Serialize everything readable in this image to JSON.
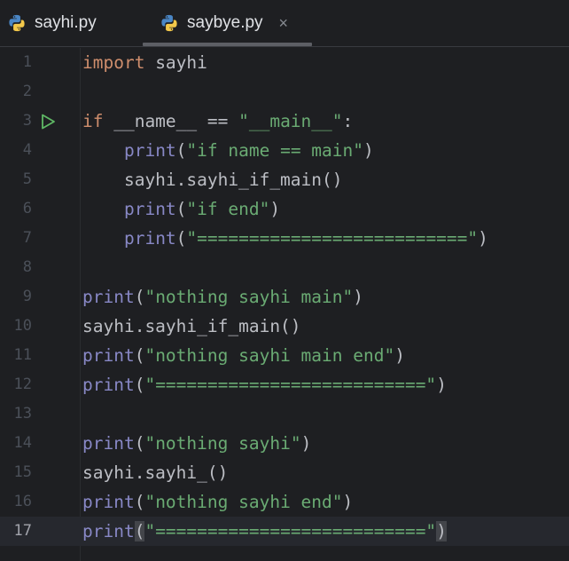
{
  "tabs": [
    {
      "label": "sayhi.py",
      "active": false
    },
    {
      "label": "saybye.py",
      "active": true,
      "close_glyph": "×"
    }
  ],
  "colors": {
    "background": "#1e1f22",
    "keyword": "#cf8e6d",
    "builtin": "#8888c6",
    "string": "#6aab73",
    "identifier": "#bcbec4",
    "run_gutter_icon": "#5fb865"
  },
  "icons": {
    "tab_icon": "python-icon",
    "gutter_icon": "run-icon"
  },
  "editor": {
    "current_line": 17,
    "run_icon_line": 3,
    "lines": [
      {
        "num": "1",
        "tokens": [
          {
            "t": "import",
            "c": "kw"
          },
          {
            "t": " sayhi",
            "c": "id"
          }
        ]
      },
      {
        "num": "2",
        "tokens": []
      },
      {
        "num": "3",
        "tokens": [
          {
            "t": "if",
            "c": "kw"
          },
          {
            "t": " __name__ == ",
            "c": "id"
          },
          {
            "t": "\"__main__\"",
            "c": "str"
          },
          {
            "t": ":",
            "c": "id"
          }
        ]
      },
      {
        "num": "4",
        "tokens": [
          {
            "t": "    ",
            "c": "id"
          },
          {
            "t": "print",
            "c": "bi"
          },
          {
            "t": "(",
            "c": "id"
          },
          {
            "t": "\"if name == main\"",
            "c": "str"
          },
          {
            "t": ")",
            "c": "id"
          }
        ]
      },
      {
        "num": "5",
        "tokens": [
          {
            "t": "    sayhi.sayhi_if_main()",
            "c": "id"
          }
        ]
      },
      {
        "num": "6",
        "tokens": [
          {
            "t": "    ",
            "c": "id"
          },
          {
            "t": "print",
            "c": "bi"
          },
          {
            "t": "(",
            "c": "id"
          },
          {
            "t": "\"if end\"",
            "c": "str"
          },
          {
            "t": ")",
            "c": "id"
          }
        ]
      },
      {
        "num": "7",
        "tokens": [
          {
            "t": "    ",
            "c": "id"
          },
          {
            "t": "print",
            "c": "bi"
          },
          {
            "t": "(",
            "c": "id"
          },
          {
            "t": "\"==========================\"",
            "c": "str"
          },
          {
            "t": ")",
            "c": "id"
          }
        ]
      },
      {
        "num": "8",
        "tokens": []
      },
      {
        "num": "9",
        "tokens": [
          {
            "t": "print",
            "c": "bi"
          },
          {
            "t": "(",
            "c": "id"
          },
          {
            "t": "\"nothing sayhi main\"",
            "c": "str"
          },
          {
            "t": ")",
            "c": "id"
          }
        ]
      },
      {
        "num": "10",
        "tokens": [
          {
            "t": "sayhi.sayhi_if_main()",
            "c": "id"
          }
        ]
      },
      {
        "num": "11",
        "tokens": [
          {
            "t": "print",
            "c": "bi"
          },
          {
            "t": "(",
            "c": "id"
          },
          {
            "t": "\"nothing sayhi main end\"",
            "c": "str"
          },
          {
            "t": ")",
            "c": "id"
          }
        ]
      },
      {
        "num": "12",
        "tokens": [
          {
            "t": "print",
            "c": "bi"
          },
          {
            "t": "(",
            "c": "id"
          },
          {
            "t": "\"==========================\"",
            "c": "str"
          },
          {
            "t": ")",
            "c": "id"
          }
        ]
      },
      {
        "num": "13",
        "tokens": []
      },
      {
        "num": "14",
        "tokens": [
          {
            "t": "print",
            "c": "bi"
          },
          {
            "t": "(",
            "c": "id"
          },
          {
            "t": "\"nothing sayhi\"",
            "c": "str"
          },
          {
            "t": ")",
            "c": "id"
          }
        ]
      },
      {
        "num": "15",
        "tokens": [
          {
            "t": "sayhi.sayhi_()",
            "c": "id"
          }
        ]
      },
      {
        "num": "16",
        "tokens": [
          {
            "t": "print",
            "c": "bi"
          },
          {
            "t": "(",
            "c": "id"
          },
          {
            "t": "\"nothing sayhi end\"",
            "c": "str"
          },
          {
            "t": ")",
            "c": "id"
          }
        ]
      },
      {
        "num": "17",
        "tokens": [
          {
            "t": "print",
            "c": "bi"
          },
          {
            "t": "(",
            "c": "id",
            "hl": true
          },
          {
            "t": "\"==========================\"",
            "c": "str"
          },
          {
            "t": ")",
            "c": "id",
            "hl": true
          }
        ]
      }
    ]
  }
}
